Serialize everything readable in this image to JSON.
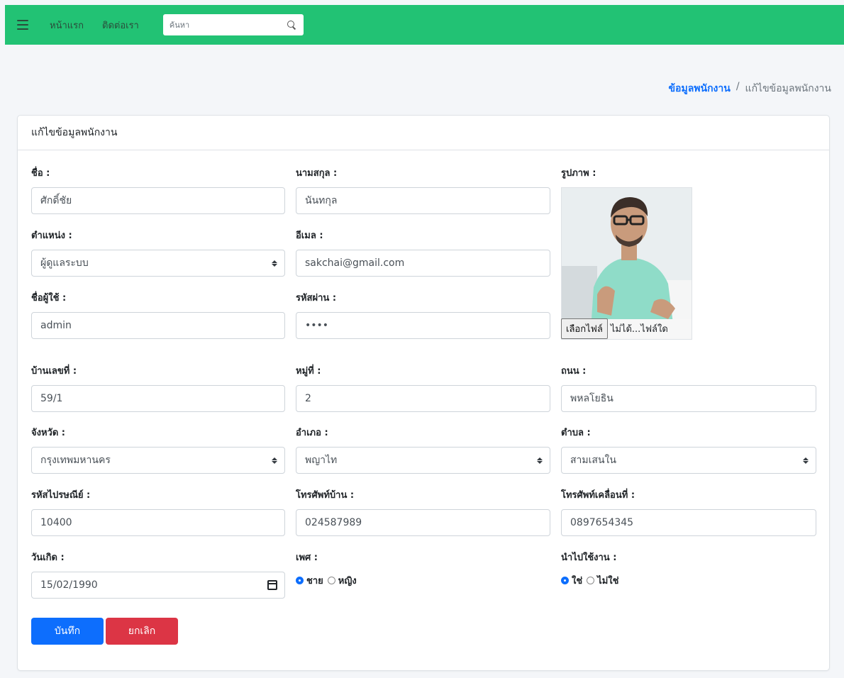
{
  "nav": {
    "home": "หน้าแรก",
    "contact": "ติดต่อเรา",
    "search_placeholder": "ค้นหา"
  },
  "breadcrumb": {
    "parent": "ข้อมูลพนักงาน",
    "separator": "/",
    "current": "แก้ไขข้อมูลพนักงาน"
  },
  "card": {
    "title": "แก้ไขข้อมูลพนักงาน"
  },
  "form": {
    "first_name": {
      "label": "ชื่อ :",
      "value": "ศักดิ์ชัย"
    },
    "last_name": {
      "label": "นามสกุล :",
      "value": "นันทกุล"
    },
    "photo": {
      "label": "รูปภาพ :",
      "button": "เลือกไฟล์",
      "status": "ไม่ได้...ไฟล์ใด"
    },
    "position": {
      "label": "ตำแหน่ง :",
      "value": "ผู้ดูแลระบบ"
    },
    "email": {
      "label": "อีเมล :",
      "value": "sakchai@gmail.com"
    },
    "username": {
      "label": "ชื่อผู้ใช้ :",
      "value": "admin"
    },
    "password": {
      "label": "รหัสผ่าน :",
      "value": "••••"
    },
    "house_no": {
      "label": "บ้านเลขที่ :",
      "value": "59/1"
    },
    "moo": {
      "label": "หมู่ที่ :",
      "value": "2"
    },
    "road": {
      "label": "ถนน :",
      "value": "พหลโยธิน"
    },
    "province": {
      "label": "จังหวัด :",
      "value": "กรุงเทพมหานคร"
    },
    "district": {
      "label": "อำเภอ :",
      "value": "พญาไท"
    },
    "subdistrict": {
      "label": "ตำบล :",
      "value": "สามเสนใน"
    },
    "postcode": {
      "label": "รหัสไปรษณีย์ :",
      "value": "10400"
    },
    "home_phone": {
      "label": "โทรศัพท์บ้าน :",
      "value": "024587989"
    },
    "mobile_phone": {
      "label": "โทรศัพท์เคลื่อนที่ :",
      "value": "0897654345"
    },
    "birthdate": {
      "label": "วันเกิด :",
      "value": "15/02/1990"
    },
    "gender": {
      "label": "เพศ :",
      "options": [
        "ชาย",
        "หญิง"
      ],
      "selected": "ชาย"
    },
    "active": {
      "label": "นำไปใช้งาน :",
      "options": [
        "ใช่",
        "ไม่ใช่"
      ],
      "selected": "ใช่"
    }
  },
  "buttons": {
    "save": "บันทึก",
    "cancel": "ยกเลิก"
  },
  "colors": {
    "topbar": "#22c274",
    "primary": "#0d6efd",
    "danger": "#dc3545"
  }
}
